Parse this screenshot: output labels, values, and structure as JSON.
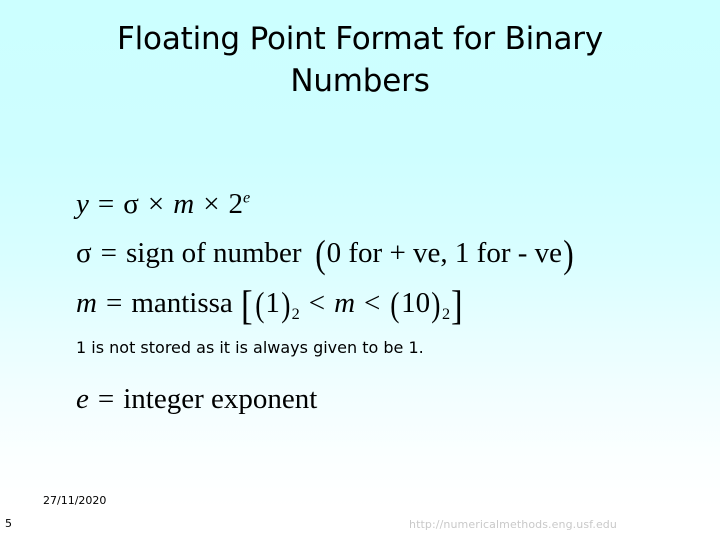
{
  "slide": {
    "title": "Floating Point Format for Binary Numbers",
    "background_top_color": "#ccffff",
    "background_bottom_color": "#ffffff"
  },
  "equations": {
    "line1": {
      "lhs": "y",
      "eq": "=",
      "sigma": "σ",
      "times1": "×",
      "m": "m",
      "times2": "×",
      "base": "2",
      "exponent": "e",
      "plain": "y = σ × m × 2^e"
    },
    "line2": {
      "lhs": "σ",
      "eq": "=",
      "text": "sign of number",
      "paren_open": "(",
      "condition": "0 for + ve, 1 for - ve",
      "paren_close": ")",
      "plain": "σ = sign of number (0 for + ve, 1 for - ve)"
    },
    "line3": {
      "lhs": "m",
      "eq": "=",
      "text": "mantissa",
      "bracket_open": "[",
      "lower_open": "(",
      "lower_value": "1",
      "lower_close": ")",
      "lower_sub": "2",
      "lt1": "<",
      "var": "m",
      "lt2": "<",
      "upper_open": "(",
      "upper_value": "10",
      "upper_close": ")",
      "upper_sub": "2",
      "bracket_close": "]",
      "plain": "m = mantissa [(1)₂ < m < (10)₂]"
    },
    "note": "1 is not stored as it is always given to be 1.",
    "line4": {
      "lhs": "e",
      "eq": "=",
      "text": "integer exponent",
      "plain": "e = integer exponent"
    }
  },
  "footer": {
    "date": "27/11/2020",
    "slide_number": "5",
    "url": "http://numericalmethods.eng.usf.edu",
    "url_color": "#c9c9c9"
  }
}
